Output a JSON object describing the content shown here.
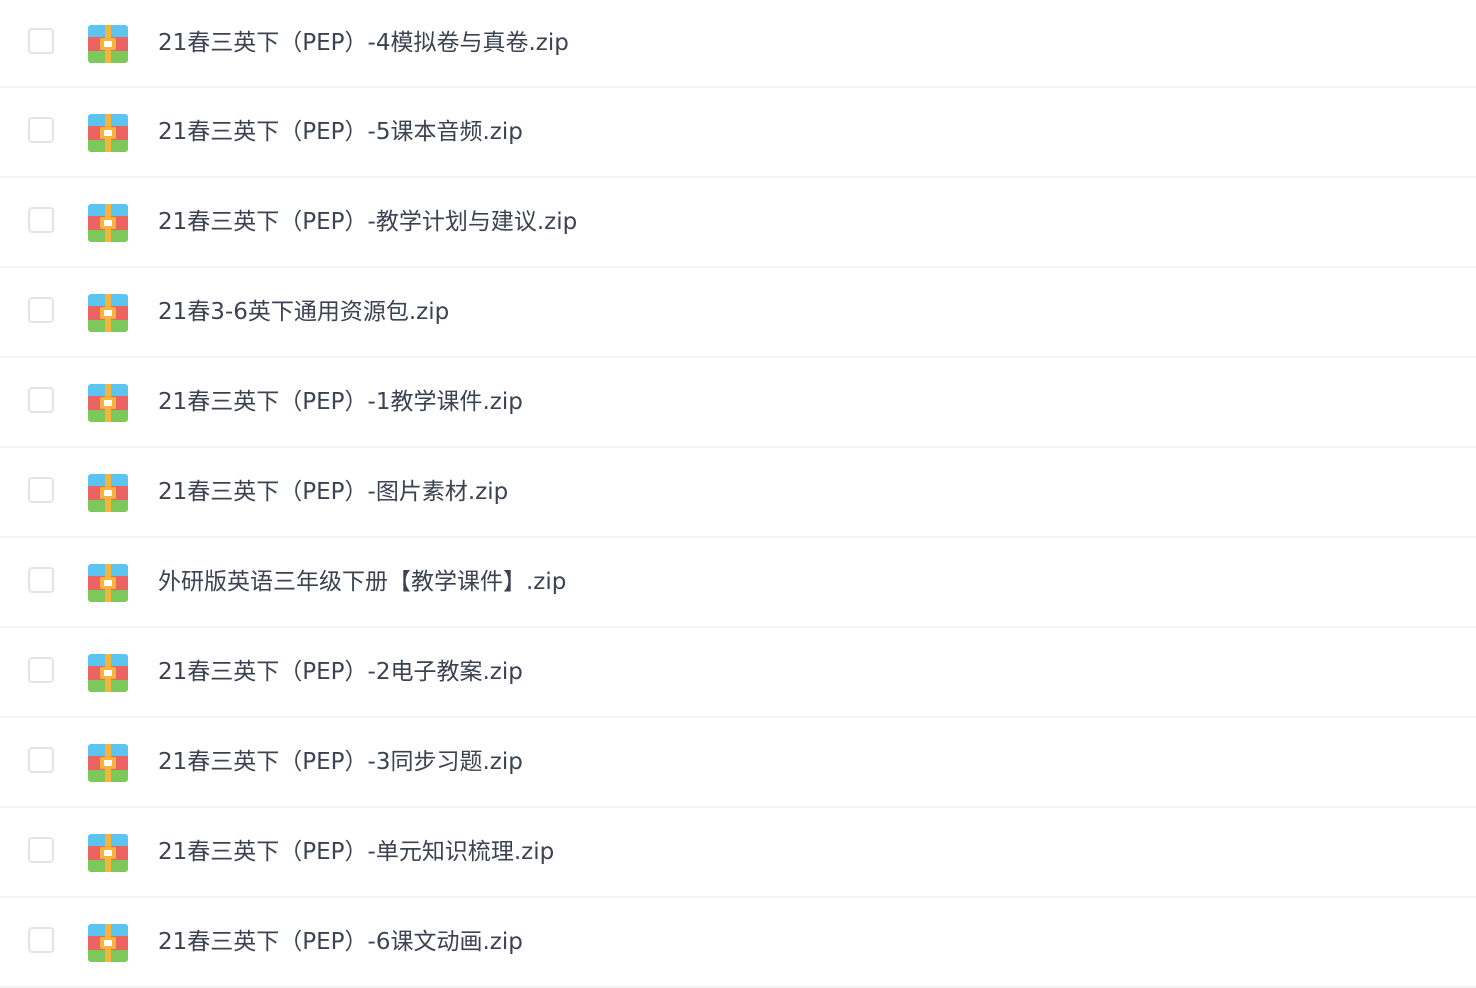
{
  "file_list": {
    "items": [
      {
        "name": "21春三英下（PEP）-4模拟卷与真卷.zip",
        "icon": "zip-archive-icon"
      },
      {
        "name": "21春三英下（PEP）-5课本音频.zip",
        "icon": "zip-archive-icon"
      },
      {
        "name": "21春三英下（PEP）-教学计划与建议.zip",
        "icon": "zip-archive-icon"
      },
      {
        "name": "21春3-6英下通用资源包.zip",
        "icon": "zip-archive-icon"
      },
      {
        "name": "21春三英下（PEP）-1教学课件.zip",
        "icon": "zip-archive-icon"
      },
      {
        "name": "21春三英下（PEP）-图片素材.zip",
        "icon": "zip-archive-icon"
      },
      {
        "name": "外研版英语三年级下册【教学课件】.zip",
        "icon": "zip-archive-icon"
      },
      {
        "name": "21春三英下（PEP）-2电子教案.zip",
        "icon": "zip-archive-icon"
      },
      {
        "name": "21春三英下（PEP）-3同步习题.zip",
        "icon": "zip-archive-icon"
      },
      {
        "name": "21春三英下（PEP）-单元知识梳理.zip",
        "icon": "zip-archive-icon"
      },
      {
        "name": "21春三英下（PEP）-6课文动画.zip",
        "icon": "zip-archive-icon"
      }
    ]
  },
  "colors": {
    "text": "#3b4252",
    "divider": "#f2f4f7",
    "checkbox_border": "#e2e4e8",
    "icon_blue": "#5bc4f0",
    "icon_red": "#ec6363",
    "icon_green": "#7cc85a",
    "icon_clasp": "#f5b43c"
  }
}
